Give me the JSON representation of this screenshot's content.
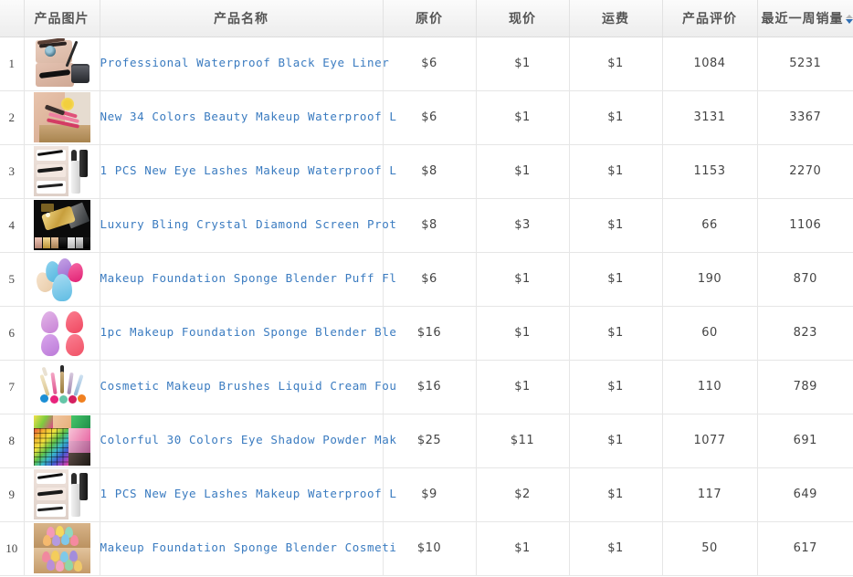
{
  "table": {
    "columns": [
      {
        "key": "index",
        "label": "",
        "sortable": false
      },
      {
        "key": "image",
        "label": "产品图片",
        "sortable": false
      },
      {
        "key": "name",
        "label": "产品名称",
        "sortable": false
      },
      {
        "key": "price",
        "label": "原价",
        "sortable": false
      },
      {
        "key": "cprice",
        "label": "现价",
        "sortable": false
      },
      {
        "key": "ship",
        "label": "运费",
        "sortable": false
      },
      {
        "key": "rating",
        "label": "产品评价",
        "sortable": false
      },
      {
        "key": "sales",
        "label": "最近一周销量",
        "sortable": true,
        "sort_direction": "desc"
      }
    ],
    "rows": [
      {
        "index": "1",
        "image_name": "eyeliner-thumbnail",
        "name": "Professional Waterproof Black Eye Liner",
        "price": "$6",
        "cprice": "$1",
        "ship": "$1",
        "rating": "1084",
        "sales": "5231"
      },
      {
        "index": "2",
        "image_name": "makeup-brushes-flower-thumbnail",
        "name": "New 34 Colors Beauty Makeup Waterproof L",
        "price": "$6",
        "cprice": "$1",
        "ship": "$1",
        "rating": "3131",
        "sales": "3367"
      },
      {
        "index": "3",
        "image_name": "mascara-eyelashes-thumbnail",
        "name": "1 PCS New Eye Lashes Makeup Waterproof L",
        "price": "$8",
        "cprice": "$1",
        "ship": "$1",
        "rating": "1153",
        "sales": "2270"
      },
      {
        "index": "4",
        "image_name": "gold-screen-protector-thumbnail",
        "name": "Luxury Bling Crystal Diamond Screen Prot",
        "price": "$8",
        "cprice": "$3",
        "ship": "$1",
        "rating": "66",
        "sales": "1106"
      },
      {
        "index": "5",
        "image_name": "sponge-blender-group-thumbnail",
        "name": "Makeup Foundation Sponge Blender Puff Fl",
        "price": "$6",
        "cprice": "$1",
        "ship": "$1",
        "rating": "190",
        "sales": "870"
      },
      {
        "index": "6",
        "image_name": "four-sponge-blenders-thumbnail",
        "name": "1pc Makeup Foundation Sponge Blender Ble",
        "price": "$16",
        "cprice": "$1",
        "ship": "$1",
        "rating": "60",
        "sales": "823"
      },
      {
        "index": "7",
        "image_name": "cosmetic-brushes-thumbnail",
        "name": "Cosmetic Makeup Brushes Liquid Cream Fou",
        "price": "$16",
        "cprice": "$1",
        "ship": "$1",
        "rating": "110",
        "sales": "789"
      },
      {
        "index": "8",
        "image_name": "eyeshadow-palette-thumbnail",
        "name": "Colorful 30 Colors Eye Shadow Powder Mak",
        "price": "$25",
        "cprice": "$11",
        "ship": "$1",
        "rating": "1077",
        "sales": "691"
      },
      {
        "index": "9",
        "image_name": "mascara-eyelashes-thumbnail",
        "name": "1 PCS New Eye Lashes Makeup Waterproof L",
        "price": "$9",
        "cprice": "$2",
        "ship": "$1",
        "rating": "117",
        "sales": "649"
      },
      {
        "index": "10",
        "image_name": "wood-sponges-thumbnail",
        "name": "Makeup Foundation Sponge Blender Cosmeti",
        "price": "$10",
        "cprice": "$1",
        "ship": "$1",
        "rating": "50",
        "sales": "617"
      }
    ]
  },
  "colors": {
    "link": "#3a7bc0",
    "header_text": "#555555",
    "sort_active": "#2f6fb5",
    "sort_inactive": "#b6b6b6",
    "border": "#e6e6e6"
  }
}
